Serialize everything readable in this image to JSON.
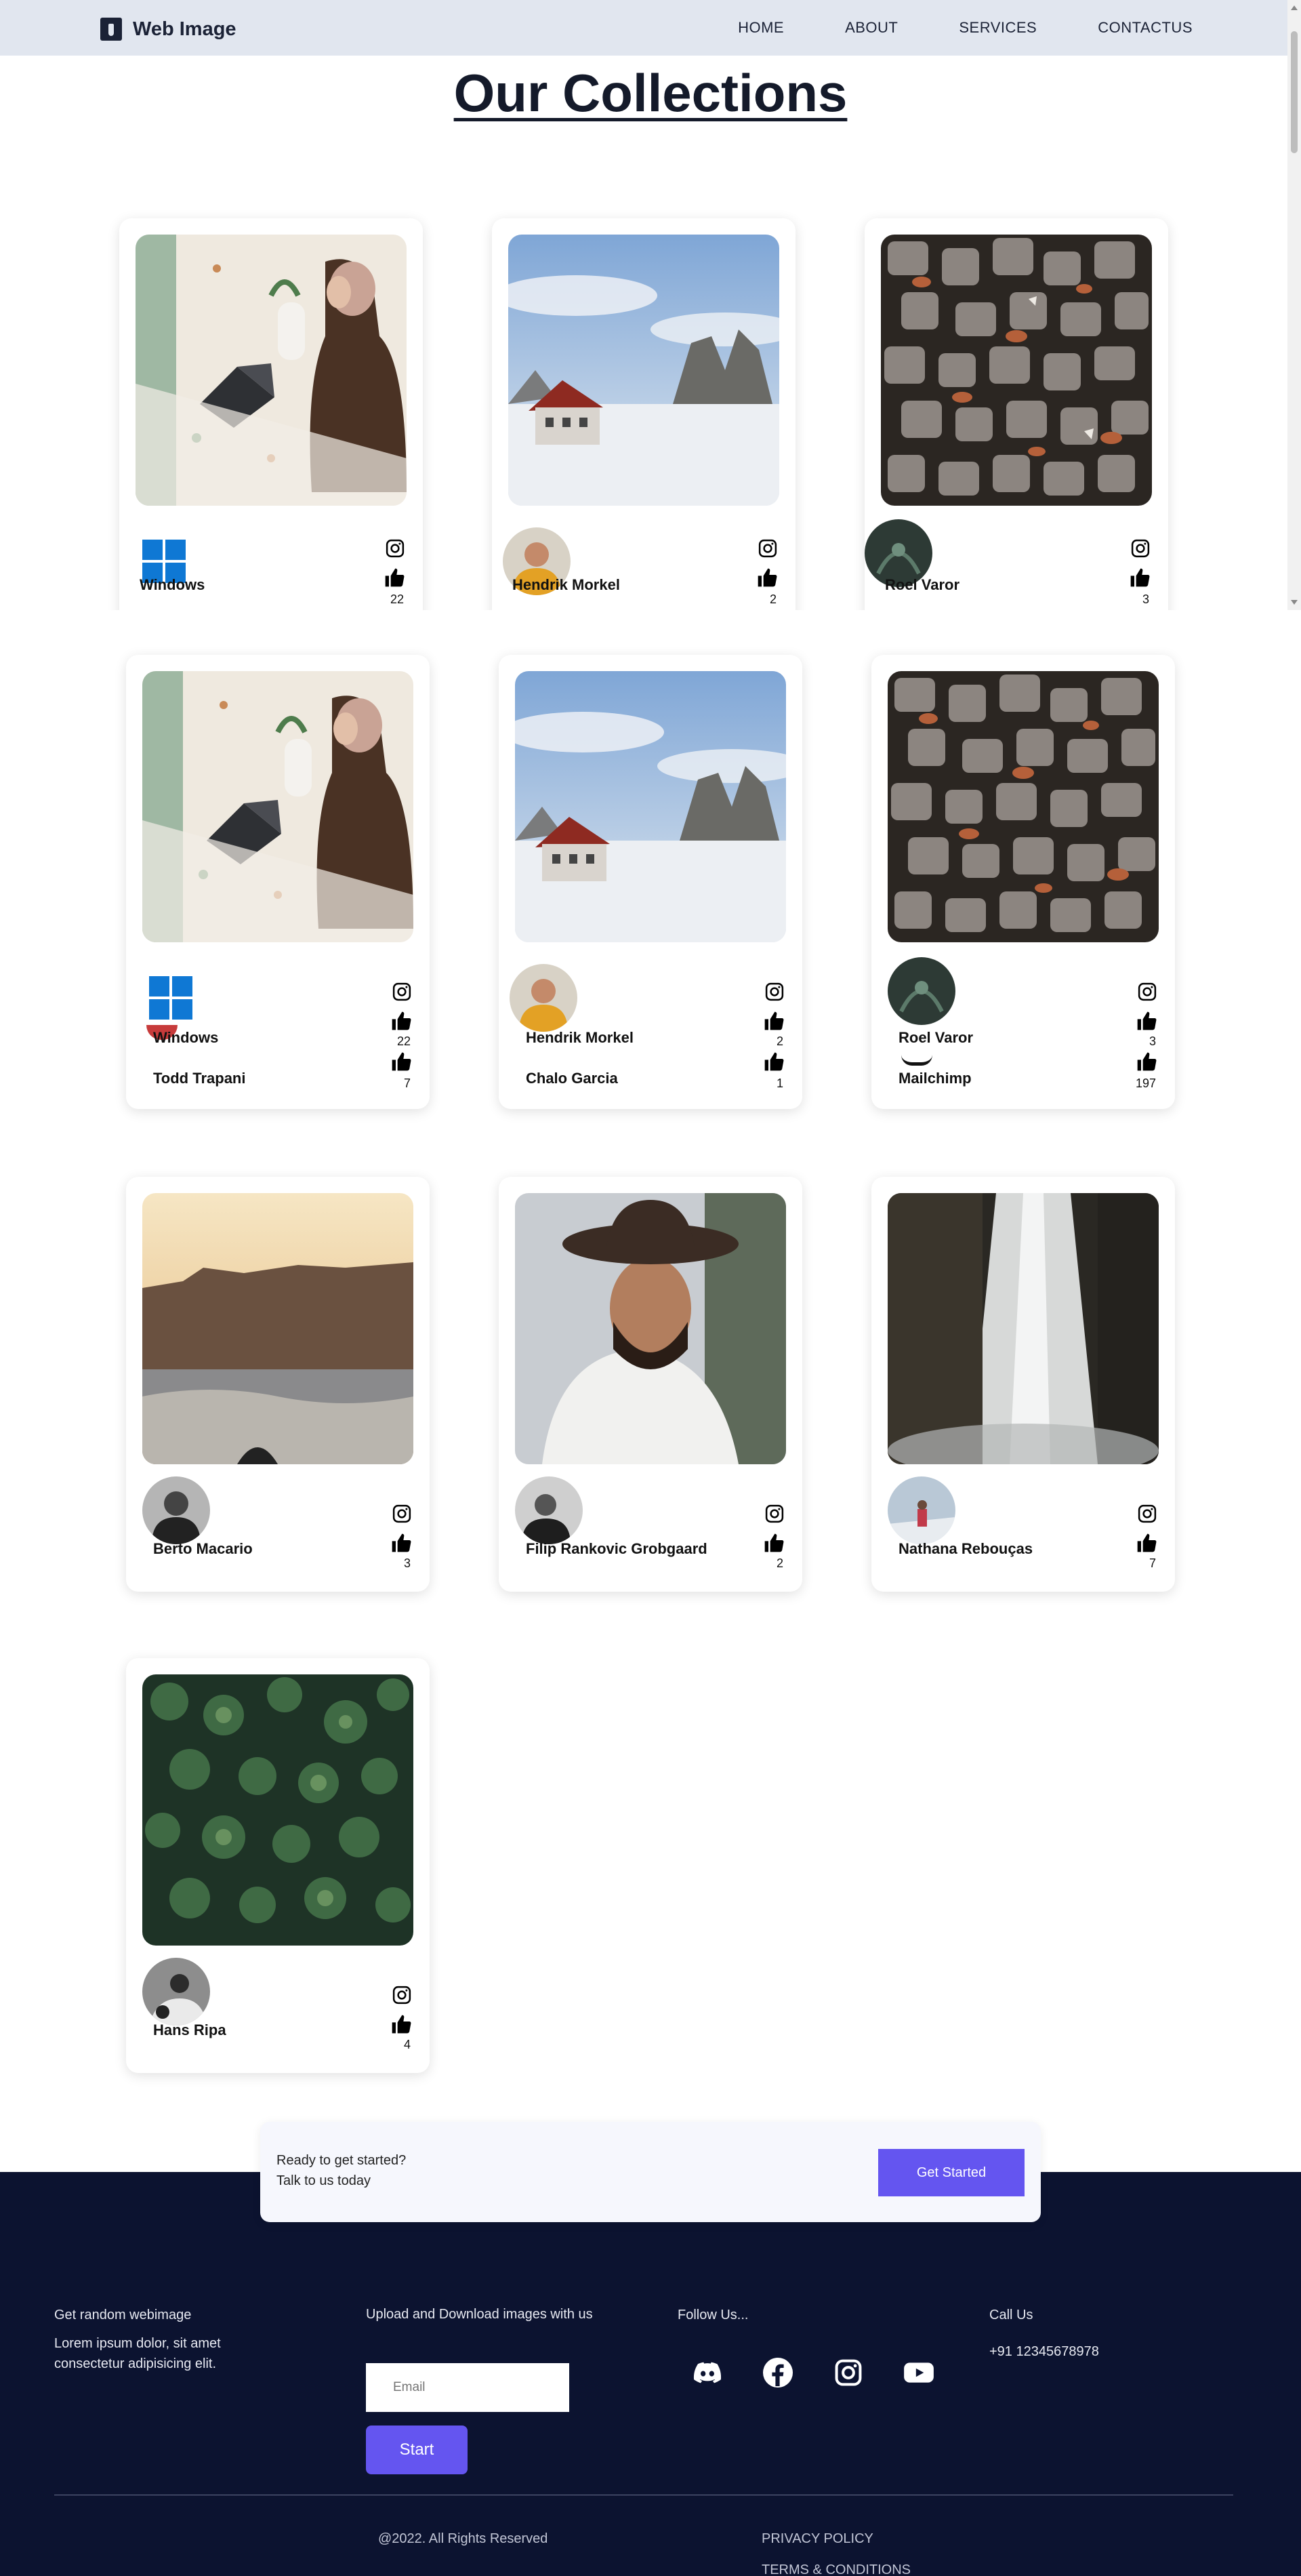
{
  "nav": {
    "brand": "Web Image",
    "links": [
      "HOME",
      "ABOUT",
      "SERVICES",
      "CONTACTUS"
    ]
  },
  "page_title": "Our Collections",
  "section1_cards": [
    {
      "author": "Windows",
      "likes": "22",
      "photo": "woman-laptop",
      "avatar": "windows-logo"
    },
    {
      "author": "Hendrik Morkel",
      "likes": "2",
      "photo": "snowy-mountain-hut",
      "avatar": "hiker-yellow-jacket"
    },
    {
      "author": "Roel Varor",
      "likes": "3",
      "photo": "cobblestone-leaves",
      "avatar": "dark-foliage"
    }
  ],
  "section2_cards": [
    {
      "author": "Windows",
      "author2": "Todd Trapani",
      "likes": "22",
      "likes2": "7",
      "photo": "woman-laptop",
      "avatar": "windows-logo"
    },
    {
      "author": "Hendrik Morkel",
      "author2": "Chalo Garcia",
      "likes": "2",
      "likes2": "1",
      "photo": "snowy-mountain-hut",
      "avatar": "hiker-yellow-jacket"
    },
    {
      "author": "Roel Varor",
      "author2": "Mailchimp",
      "likes": "3",
      "likes2": "197",
      "photo": "cobblestone-leaves",
      "avatar": "dark-foliage"
    },
    {
      "author": "Berto Macario",
      "likes": "3",
      "photo": "sunset-sea",
      "avatar": "bw-portrait"
    },
    {
      "author": "Filip Rankovic Grobgaard",
      "likes": "2",
      "photo": "man-in-hat",
      "avatar": "bw-man"
    },
    {
      "author": "Nathana Rebouças",
      "likes": "7",
      "photo": "waterfall",
      "avatar": "person-red-coat"
    },
    {
      "author": "Hans Ripa",
      "likes": "4",
      "photo": "forest-aerial",
      "avatar": "bw-rider"
    }
  ],
  "cta": {
    "line1": "Ready to get started?",
    "line2": "Talk to us today",
    "button": "Get Started"
  },
  "footer": {
    "col1_title": "Get random webimage",
    "col1_text": "Lorem ipsum dolor, sit amet consectetur adipisicing elit.",
    "col2_title": "Upload and Download images with us",
    "email_placeholder": "Email",
    "start_button": "Start",
    "col3_title": "Follow Us...",
    "socials": [
      "discord-icon",
      "facebook-icon",
      "instagram-icon",
      "youtube-icon"
    ],
    "col4_title": "Call Us",
    "phone": "+91 12345678978",
    "copyright": "@2022. All Rights Reserved",
    "privacy": "PRIVACY POLICY",
    "terms": "TERMS & CONDITIONS"
  }
}
